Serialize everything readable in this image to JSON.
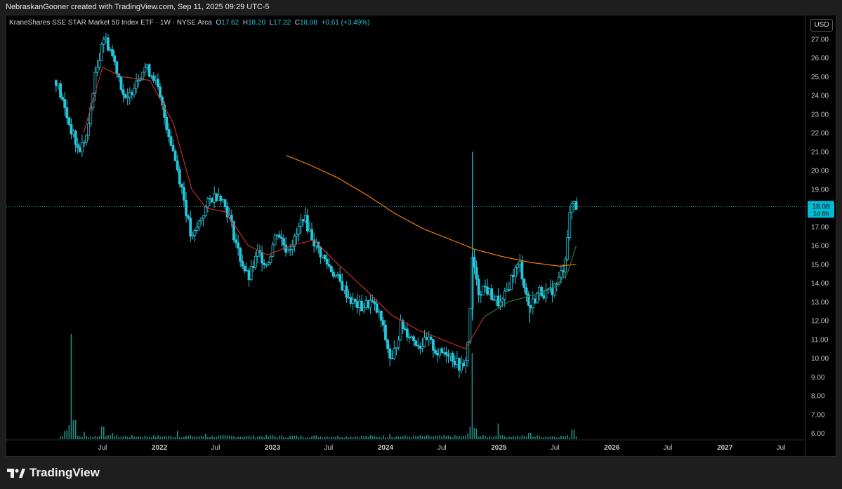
{
  "header": {
    "attribution": "NebraskanGooner created with TradingView.com, Sep 11, 2025 09:29 UTC-5"
  },
  "legend": {
    "symbol": "KraneShares SSE STAR Market 50 Index ETF · 1W · NYSE Arca",
    "open_label": "O",
    "open": "17.62",
    "high_label": "H",
    "high": "18.20",
    "low_label": "L",
    "low": "17.22",
    "close_label": "C",
    "close": "18.08",
    "change": "+0.61 (+3.49%)"
  },
  "currency": "USD",
  "price_tag": {
    "price": "18.08",
    "countdown": "1d 6h"
  },
  "footer": {
    "brand": "TradingView"
  },
  "colors": {
    "up": "#26c6da",
    "down": "#26c6da",
    "ema_slow": "#f57c00",
    "ema_fast_red": "#d32f2f",
    "ema_fast_green": "#2e7d32"
  },
  "chart_data": {
    "type": "candlestick",
    "timeframe": "1W",
    "ylim": [
      6.0,
      27.5
    ],
    "y_ticks": [
      "6.00",
      "7.00",
      "8.00",
      "9.00",
      "10.00",
      "11.00",
      "12.00",
      "13.00",
      "14.00",
      "15.00",
      "16.00",
      "17.00",
      "18.00",
      "19.00",
      "20.00",
      "21.00",
      "22.00",
      "23.00",
      "24.00",
      "25.00",
      "26.00",
      "27.00"
    ],
    "x_ticks": [
      "Jul",
      "2022",
      "Jul",
      "2023",
      "Jul",
      "2024",
      "Jul",
      "2025",
      "Jul",
      "2026",
      "Jul",
      "2027",
      "Jul"
    ],
    "x_tick_dates": [
      "2021-07-01",
      "2022-01-01",
      "2022-07-01",
      "2023-01-01",
      "2023-07-01",
      "2024-01-01",
      "2024-07-01",
      "2025-01-01",
      "2025-07-01",
      "2026-01-01",
      "2026-07-01",
      "2027-01-01",
      "2027-07-01"
    ],
    "grid": false,
    "last_price": 18.08,
    "price_path": [
      {
        "date": "2021-02-01",
        "close": 24.8
      },
      {
        "date": "2021-03-15",
        "close": 22.5
      },
      {
        "date": "2021-04-15",
        "close": 21.0
      },
      {
        "date": "2021-05-15",
        "close": 22.0
      },
      {
        "date": "2021-06-01",
        "close": 24.5
      },
      {
        "date": "2021-06-20",
        "close": 26.0
      },
      {
        "date": "2021-07-01",
        "close": 27.2
      },
      {
        "date": "2021-07-25",
        "close": 26.5
      },
      {
        "date": "2021-08-20",
        "close": 25.2
      },
      {
        "date": "2021-09-15",
        "close": 23.5
      },
      {
        "date": "2021-10-15",
        "close": 24.8
      },
      {
        "date": "2021-11-15",
        "close": 25.5
      },
      {
        "date": "2021-12-15",
        "close": 25.0
      },
      {
        "date": "2022-01-15",
        "close": 23.0
      },
      {
        "date": "2022-02-15",
        "close": 21.0
      },
      {
        "date": "2022-03-15",
        "close": 19.0
      },
      {
        "date": "2022-04-15",
        "close": 16.2
      },
      {
        "date": "2022-05-15",
        "close": 17.5
      },
      {
        "date": "2022-06-15",
        "close": 18.5
      },
      {
        "date": "2022-07-15",
        "close": 18.8
      },
      {
        "date": "2022-08-15",
        "close": 17.5
      },
      {
        "date": "2022-09-15",
        "close": 15.5
      },
      {
        "date": "2022-10-15",
        "close": 14.2
      },
      {
        "date": "2022-11-15",
        "close": 15.6
      },
      {
        "date": "2022-12-15",
        "close": 15.0
      },
      {
        "date": "2023-01-15",
        "close": 16.8
      },
      {
        "date": "2023-02-15",
        "close": 15.8
      },
      {
        "date": "2023-03-15",
        "close": 16.3
      },
      {
        "date": "2023-04-10",
        "close": 17.6
      },
      {
        "date": "2023-05-15",
        "close": 16.2
      },
      {
        "date": "2023-06-15",
        "close": 15.3
      },
      {
        "date": "2023-07-15",
        "close": 14.6
      },
      {
        "date": "2023-08-15",
        "close": 13.8
      },
      {
        "date": "2023-09-15",
        "close": 13.0
      },
      {
        "date": "2023-10-15",
        "close": 12.7
      },
      {
        "date": "2023-11-15",
        "close": 13.0
      },
      {
        "date": "2023-12-15",
        "close": 12.2
      },
      {
        "date": "2024-01-20",
        "close": 9.7
      },
      {
        "date": "2024-02-20",
        "close": 11.8
      },
      {
        "date": "2024-03-20",
        "close": 11.2
      },
      {
        "date": "2024-04-20",
        "close": 10.7
      },
      {
        "date": "2024-05-20",
        "close": 10.9
      },
      {
        "date": "2024-06-20",
        "close": 10.2
      },
      {
        "date": "2024-07-20",
        "close": 10.4
      },
      {
        "date": "2024-08-20",
        "close": 9.7
      },
      {
        "date": "2024-09-10",
        "close": 9.4
      },
      {
        "date": "2024-09-25",
        "close": 11.0
      },
      {
        "date": "2024-10-08",
        "close": 15.5
      },
      {
        "date": "2024-10-25",
        "close": 13.5
      },
      {
        "date": "2024-11-15",
        "close": 13.8
      },
      {
        "date": "2024-12-15",
        "close": 13.2
      },
      {
        "date": "2025-01-10",
        "close": 12.8
      },
      {
        "date": "2025-02-15",
        "close": 14.5
      },
      {
        "date": "2025-03-10",
        "close": 15.0
      },
      {
        "date": "2025-04-10",
        "close": 12.6
      },
      {
        "date": "2025-05-10",
        "close": 13.6
      },
      {
        "date": "2025-06-10",
        "close": 13.4
      },
      {
        "date": "2025-07-10",
        "close": 14.0
      },
      {
        "date": "2025-08-01",
        "close": 15.0
      },
      {
        "date": "2025-08-15",
        "close": 17.2
      },
      {
        "date": "2025-08-28",
        "close": 18.5
      },
      {
        "date": "2025-09-08",
        "close": 18.08
      }
    ],
    "spikes": [
      {
        "date": "2024-10-08",
        "high": 21.0,
        "low": 12.0
      },
      {
        "date": "2025-04-10",
        "high": 13.0,
        "low": 11.9
      }
    ],
    "ema_fast": [
      {
        "date": "2021-05-01",
        "value": 22.0
      },
      {
        "date": "2021-07-01",
        "value": 25.5
      },
      {
        "date": "2021-09-01",
        "value": 25.0
      },
      {
        "date": "2021-12-01",
        "value": 24.8
      },
      {
        "date": "2022-02-15",
        "value": 22.5
      },
      {
        "date": "2022-04-15",
        "value": 19.0
      },
      {
        "date": "2022-06-01",
        "value": 18.0
      },
      {
        "date": "2022-08-01",
        "value": 17.8
      },
      {
        "date": "2022-10-15",
        "value": 16.0
      },
      {
        "date": "2022-12-15",
        "value": 15.5
      },
      {
        "date": "2023-03-01",
        "value": 16.0
      },
      {
        "date": "2023-05-15",
        "value": 16.3
      },
      {
        "date": "2023-08-01",
        "value": 15.0
      },
      {
        "date": "2023-11-01",
        "value": 13.6
      },
      {
        "date": "2024-01-20",
        "value": 12.3
      },
      {
        "date": "2024-04-15",
        "value": 11.5
      },
      {
        "date": "2024-07-15",
        "value": 10.9
      },
      {
        "date": "2024-09-15",
        "value": 10.5
      },
      {
        "date": "2024-11-15",
        "value": 12.2
      },
      {
        "date": "2025-02-01",
        "value": 13.0
      },
      {
        "date": "2025-05-01",
        "value": 13.4
      },
      {
        "date": "2025-07-01",
        "value": 13.8
      },
      {
        "date": "2025-08-10",
        "value": 14.5
      },
      {
        "date": "2025-09-08",
        "value": 16.0
      }
    ],
    "ema_slow": [
      {
        "date": "2023-02-15",
        "value": 20.8
      },
      {
        "date": "2023-05-01",
        "value": 20.3
      },
      {
        "date": "2023-08-01",
        "value": 19.6
      },
      {
        "date": "2023-11-01",
        "value": 18.7
      },
      {
        "date": "2024-02-01",
        "value": 17.7
      },
      {
        "date": "2024-05-01",
        "value": 16.9
      },
      {
        "date": "2024-08-01",
        "value": 16.3
      },
      {
        "date": "2024-10-15",
        "value": 15.8
      },
      {
        "date": "2025-01-15",
        "value": 15.4
      },
      {
        "date": "2025-04-15",
        "value": 15.1
      },
      {
        "date": "2025-07-15",
        "value": 14.9
      },
      {
        "date": "2025-09-08",
        "value": 15.0
      }
    ],
    "volume": [
      {
        "date": "2021-03-01",
        "value": 0.08
      },
      {
        "date": "2021-03-20",
        "value": 1.0
      },
      {
        "date": "2021-04-01",
        "value": 0.18
      },
      {
        "date": "2021-05-01",
        "value": 0.07
      },
      {
        "date": "2021-07-01",
        "value": 0.12
      },
      {
        "date": "2021-08-01",
        "value": 0.06
      },
      {
        "date": "2022-03-01",
        "value": 0.08
      },
      {
        "date": "2022-06-01",
        "value": 0.05
      },
      {
        "date": "2023-01-01",
        "value": 0.04
      },
      {
        "date": "2024-01-15",
        "value": 0.05
      },
      {
        "date": "2024-10-01",
        "value": 0.12
      },
      {
        "date": "2024-10-08",
        "value": 0.82
      },
      {
        "date": "2024-10-20",
        "value": 0.1
      },
      {
        "date": "2025-01-01",
        "value": 0.15
      },
      {
        "date": "2025-04-10",
        "value": 0.06
      },
      {
        "date": "2025-08-28",
        "value": 0.09
      }
    ]
  }
}
